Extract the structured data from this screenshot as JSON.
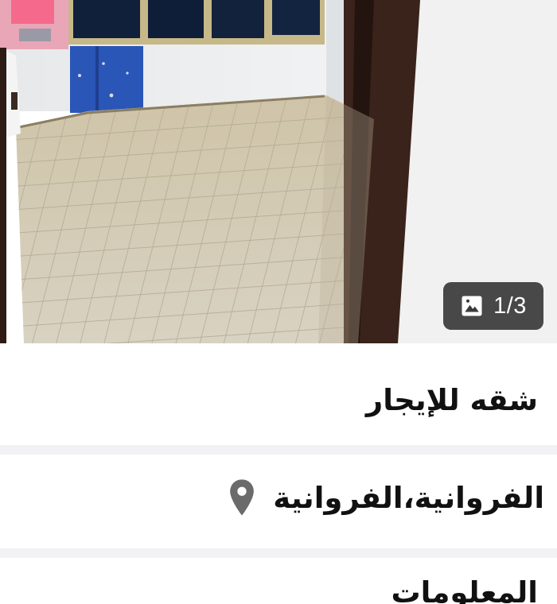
{
  "gallery": {
    "counter_text": "1/3",
    "counter_icon": "image-icon",
    "current_index": 1,
    "total_images": 3
  },
  "listing": {
    "title": "شقه للإيجار",
    "location": "الفروانية،الفروانية",
    "location_icon": "location-pin-icon"
  },
  "info_section": {
    "title": "المعلومات"
  },
  "colors": {
    "text": "#111111",
    "counter_bg": "#3a3a3a",
    "separator": "#f2f2f4",
    "pin": "#6b6b6b"
  }
}
